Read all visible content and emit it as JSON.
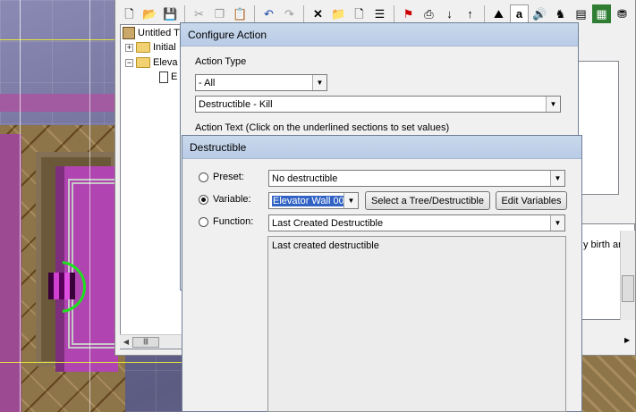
{
  "editor": {
    "tree": {
      "root_label": "Untitled T",
      "items": [
        {
          "label": "Initial",
          "expander": "+"
        },
        {
          "label": "Eleva",
          "expander": "−"
        },
        {
          "label": "E"
        }
      ]
    },
    "right_panel_text": "y birth an"
  },
  "configure_action": {
    "title": "Configure Action",
    "action_type_label": "Action Type",
    "category_value": "- All",
    "action_value": "Destructible - Kill",
    "action_text_label": "Action Text (Click on the underlined sections to set values)"
  },
  "destructible": {
    "title": "Destructible",
    "preset": {
      "label": "Preset:",
      "value": "No destructible",
      "selected": false
    },
    "variable": {
      "label": "Variable:",
      "value": "Elevator Wall 00",
      "selected": true,
      "select_button": "Select a Tree/Destructible",
      "edit_button": "Edit Variables"
    },
    "function": {
      "label": "Function:",
      "value": "Last Created Destructible",
      "selected": false
    },
    "description": "Last created destructible"
  }
}
